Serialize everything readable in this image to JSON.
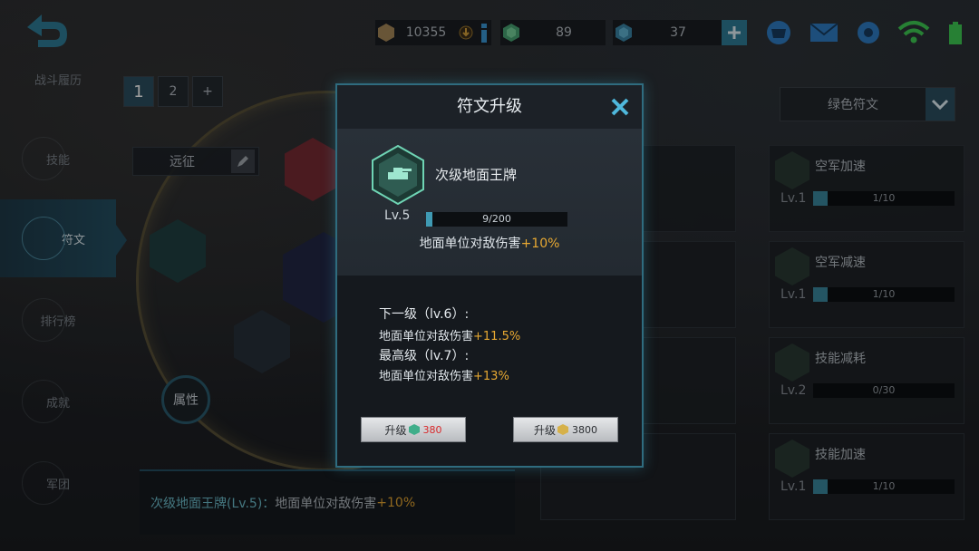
{
  "top_bar": {
    "gold": "10355",
    "green_gem": "89",
    "blue_gem": "37"
  },
  "nav": {
    "items": [
      {
        "label": "战斗履历"
      },
      {
        "label": "技能"
      },
      {
        "label": "符文"
      },
      {
        "label": "排行榜"
      },
      {
        "label": "成就"
      },
      {
        "label": "军团"
      }
    ]
  },
  "pages": {
    "tabs": [
      "1",
      "2",
      "+"
    ]
  },
  "preset": {
    "label": "远征"
  },
  "attr_button": "属性",
  "bottom_info": {
    "name": "次级地面王牌(Lv.5)：",
    "desc": "地面单位对敌伤害",
    "bonus": "+10%"
  },
  "filter": {
    "label": "绿色符文"
  },
  "cards": [
    {
      "name": "空军加速",
      "lv": "Lv.1",
      "progress": "1/10",
      "fill": 0.1
    },
    {
      "name": "空军减速",
      "lv": "Lv.1",
      "progress": "1/10",
      "fill": 0.1
    },
    {
      "name": "技能减耗",
      "lv": "Lv.2",
      "progress": "0/30",
      "fill": 0.0
    },
    {
      "name": "技能加速",
      "lv": "Lv.1",
      "progress": "1/10",
      "fill": 0.1
    }
  ],
  "modal": {
    "title": "符文升级",
    "rune_name": "次级地面王牌",
    "level": "Lv.5",
    "progress_text": "9/200",
    "progress_fraction": 0.045,
    "effect": "地面单位对敌伤害",
    "effect_bonus": "+10%",
    "next_head": "下一级（lv.6）:",
    "next_effect": "地面单位对敌伤害",
    "next_bonus": "+11.5%",
    "max_head": "最高级（lv.7）:",
    "max_effect": "地面单位对敌伤害",
    "max_bonus": "+13%",
    "btn_label": "升级",
    "btn1_cost": "380",
    "btn2_cost": "3800"
  },
  "colors": {
    "accent": "#2f6c7f",
    "bonus": "#e8a932",
    "cost_red": "#d8292b"
  }
}
